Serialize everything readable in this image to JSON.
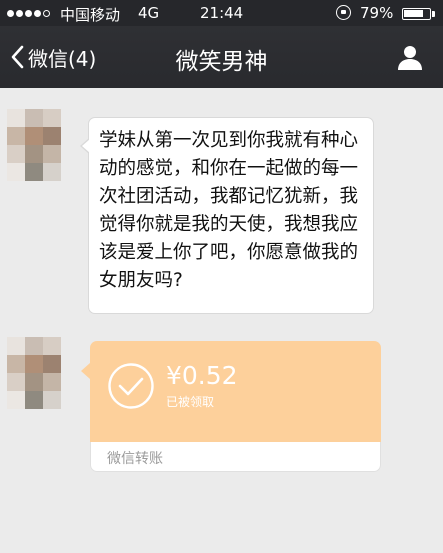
{
  "status_bar": {
    "carrier": "中国移动",
    "network": "4G",
    "time": "21:44",
    "battery_percent": "79%",
    "battery_level": 0.79,
    "signal_bars_filled": 4,
    "signal_bars_total": 5,
    "icons": [
      "signal-dots-icon",
      "rotation-lock-icon",
      "battery-icon"
    ]
  },
  "nav_bar": {
    "back_label": "微信(4)",
    "title": "微笑男神",
    "icons": [
      "chevron-left-icon",
      "person-icon"
    ]
  },
  "messages": [
    {
      "type": "text",
      "text": "学妹从第一次见到你我就有种心动的感觉，和你在一起做的每一次社团活动，我都记忆犹新，我觉得你就是我的天使，我想我应该是爱上你了吧，你愿意做我的女朋友吗?"
    },
    {
      "type": "transfer",
      "amount": "¥0.52",
      "status": "已被领取",
      "label": "微信转账",
      "icon": "check-circle-icon"
    }
  ],
  "colors": {
    "status_bar_bg": "#26272b",
    "nav_bar_bg": "#2b2c30",
    "chat_bg": "#ebebeb",
    "transfer_orange": "#fdd09b",
    "transfer_label": "#9b9b9b"
  }
}
